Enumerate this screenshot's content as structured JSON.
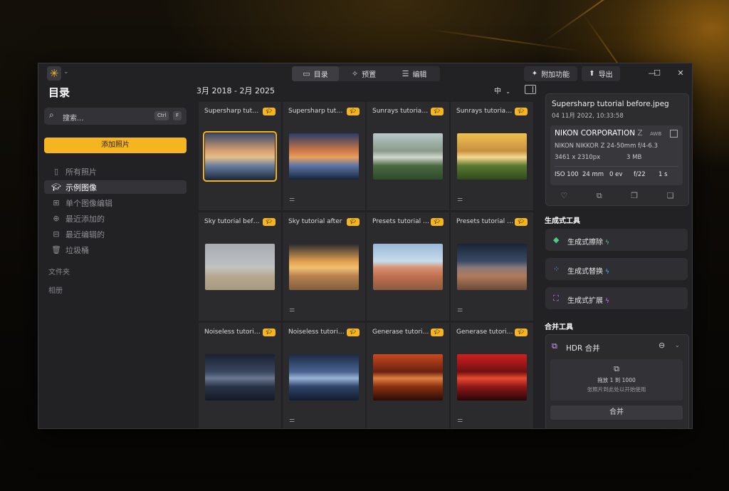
{
  "titlebar": {
    "modes": [
      {
        "label": "目录",
        "icon": "folder-icon"
      },
      {
        "label": "预置",
        "icon": "sparkle-icon"
      },
      {
        "label": "编辑",
        "icon": "sliders-icon"
      }
    ],
    "addons_label": "附加功能",
    "export_label": "导出"
  },
  "sidebar": {
    "title": "目录",
    "search_placeholder": "搜索...",
    "shortcut": [
      "Ctrl",
      "F"
    ],
    "add_photos_label": "添加照片",
    "items": [
      {
        "label": "所有照片",
        "icon": "clipboard-icon"
      },
      {
        "label": "示例图像",
        "icon": "graduation-cap-icon"
      },
      {
        "label": "单个图像编辑",
        "icon": "grid-icon"
      },
      {
        "label": "最近添加的",
        "icon": "recent-add-icon"
      },
      {
        "label": "最近编辑的",
        "icon": "recent-edit-icon"
      },
      {
        "label": "垃圾桶",
        "icon": "trash-icon"
      }
    ],
    "sections": [
      "文件夹",
      "相册"
    ]
  },
  "grid": {
    "date_range": "3月 2018 - 2月 2025",
    "thumb_size": "中",
    "cards": [
      {
        "title": "Supersharp tutorial before.jpeg",
        "edited": false,
        "selected": true,
        "colors": [
          "#3a4a6a",
          "#d8a070",
          "#e2c08a",
          "#6a7fa0",
          "#1c2a40"
        ]
      },
      {
        "title": "Supersharp tutorial after.jpeg",
        "edited": true,
        "selected": false,
        "colors": [
          "#2a3c66",
          "#d07a48",
          "#e6a060",
          "#5c76a8",
          "#18243c"
        ]
      },
      {
        "title": "Sunrays tutorial before.jpeg",
        "edited": false,
        "selected": false,
        "colors": [
          "#b8c8c8",
          "#8a9a8a",
          "#d0d8d0",
          "#4a6a40",
          "#2e4a2a"
        ]
      },
      {
        "title": "Sunrays tutorial after.jpeg",
        "edited": true,
        "selected": false,
        "colors": [
          "#f0c050",
          "#c89040",
          "#f6d890",
          "#5a7a30",
          "#2e4a1c"
        ]
      },
      {
        "title": "Sky tutorial before.jpeg",
        "edited": false,
        "selected": false,
        "colors": [
          "#a8acb0",
          "#b8bcc0",
          "#c2c2be",
          "#b6a890",
          "#a89a80"
        ]
      },
      {
        "title": "Sky tutorial after",
        "edited": true,
        "selected": false,
        "colors": [
          "#2a2a30",
          "#e0a050",
          "#f0c070",
          "#b88050",
          "#80603c"
        ]
      },
      {
        "title": "Presets tutorial before.jpeg",
        "edited": false,
        "selected": false,
        "colors": [
          "#9ab8d8",
          "#c8dcec",
          "#d89070",
          "#c07050",
          "#8a5a40"
        ]
      },
      {
        "title": "Presets tutorial after.jpeg",
        "edited": true,
        "selected": false,
        "colors": [
          "#1a2436",
          "#3a4a66",
          "#8a7a7a",
          "#b07a5a",
          "#6a4a38"
        ]
      },
      {
        "title": "Noiseless tutorial before.jpeg",
        "edited": false,
        "selected": false,
        "colors": [
          "#1a2030",
          "#3a4660",
          "#6a7890",
          "#2a3448",
          "#141a28"
        ]
      },
      {
        "title": "Noiseless tutorial after.jpeg",
        "edited": true,
        "selected": false,
        "colors": [
          "#1c2a44",
          "#4a6490",
          "#9ab4d8",
          "#2e4468",
          "#121c30"
        ]
      },
      {
        "title": "Generase tutorial before.jpeg",
        "edited": false,
        "selected": false,
        "colors": [
          "#c84a20",
          "#6a2010",
          "#e08040",
          "#8a3010",
          "#2a0c06"
        ]
      },
      {
        "title": "Generase tutorial after.jpeg",
        "edited": true,
        "selected": false,
        "colors": [
          "#d02020",
          "#701010",
          "#e84a30",
          "#901818",
          "#2a0606"
        ]
      }
    ]
  },
  "info": {
    "filename": "Supersharp tutorial before.jpeg",
    "date": "04 11月 2022, 10:33:58",
    "camera": "NIKON CORPORATION",
    "camera_suffix": "Z",
    "awb": "AWB",
    "lens": "NIKON NIKKOR Z 24-50mm f/4-6.3",
    "dimensions": "3461 x 2310px",
    "filesize": "3 MB",
    "iso": "ISO 100",
    "focal": "24 mm",
    "ev": "0 ev",
    "aperture": "f/22",
    "shutter": "1 s"
  },
  "generative": {
    "title": "生成式工具",
    "tools": [
      {
        "label": "生成式擦除",
        "icon": "eraser-icon",
        "color": "#4ad07a"
      },
      {
        "label": "生成式替换",
        "icon": "replace-icon",
        "color": "#3db8ff"
      },
      {
        "label": "生成式扩展",
        "icon": "expand-icon",
        "color": "#d070ff"
      }
    ]
  },
  "merge": {
    "title": "合并工具",
    "hdr_label": "HDR 合并",
    "drop_line1": "拖放 1 到 1000",
    "drop_line2": "张照片到此处以开始使用",
    "merge_button": "合并"
  }
}
